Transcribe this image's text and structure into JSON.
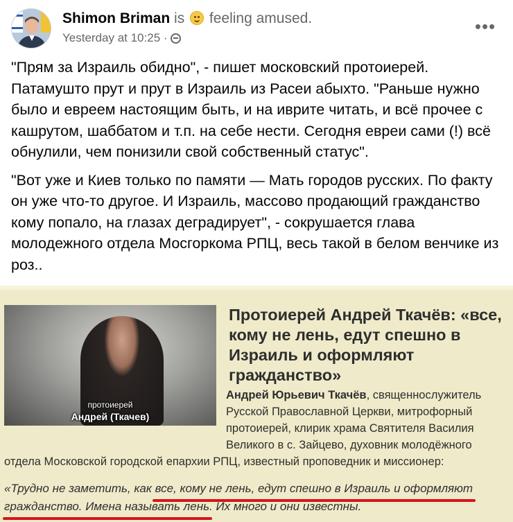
{
  "post": {
    "author": "Shimon Briman",
    "feeling_prefix": "is",
    "feeling_text": "feeling amused.",
    "timestamp": "Yesterday at 10:25",
    "separator": "·",
    "paragraph1": "\"Прям за Израиль обидно\", - пишет московский протоиерей. Патамушто прут и прут в Израиль из Расеи абыхто. \"Раньше нужно было и евреем настоящим быть, и на иврите читать, и всё прочее с кашрутом, шаббатом и т.п. на себе нести. Сегодня евреи сами (!) всё обнулили, чем понизили свой собственный статус\".",
    "paragraph2": "\"Вот уже и Киев только по памяти — Мать городов русских. По факту он уже что-то другое. И Израиль, массово продающий гражданство кому попало, на глазах деградирует\", - сокрушается глава молодежного отдела Мосгоркома РПЦ, весь такой в белом венчике из роз.."
  },
  "shared": {
    "caption_line1": "протоиерей",
    "caption_line2": "Андрей (Ткачев)",
    "title": "Протоиерей Андрей Ткачёв: «все, кому не лень, едут спешно в Израиль и оформляют гражданство»",
    "body_name": "Андрей Юрьевич Ткачёв",
    "body_rest": ", священнослужитель Русской Православной Церкви, митрофорный протоиерей, клирик храма Святителя Василия Великого в с. Зайцево, духовник молодёжного отдела Московской городской епархии РПЦ, известный проповедник и миссионер:",
    "quote_line1": "«Трудно не заметить, как все, кому не лень, едут спешно в Израиль и оформляют",
    "quote_line2": "гражданство. Имена называть лень. Их много и они известны."
  },
  "colors": {
    "shared_background": "#efebca",
    "underline": "#d8141c",
    "muted_text": "#65676b"
  },
  "icons": [
    "avatar",
    "smiling-emoji-icon",
    "globe-icon",
    "more-icon"
  ]
}
